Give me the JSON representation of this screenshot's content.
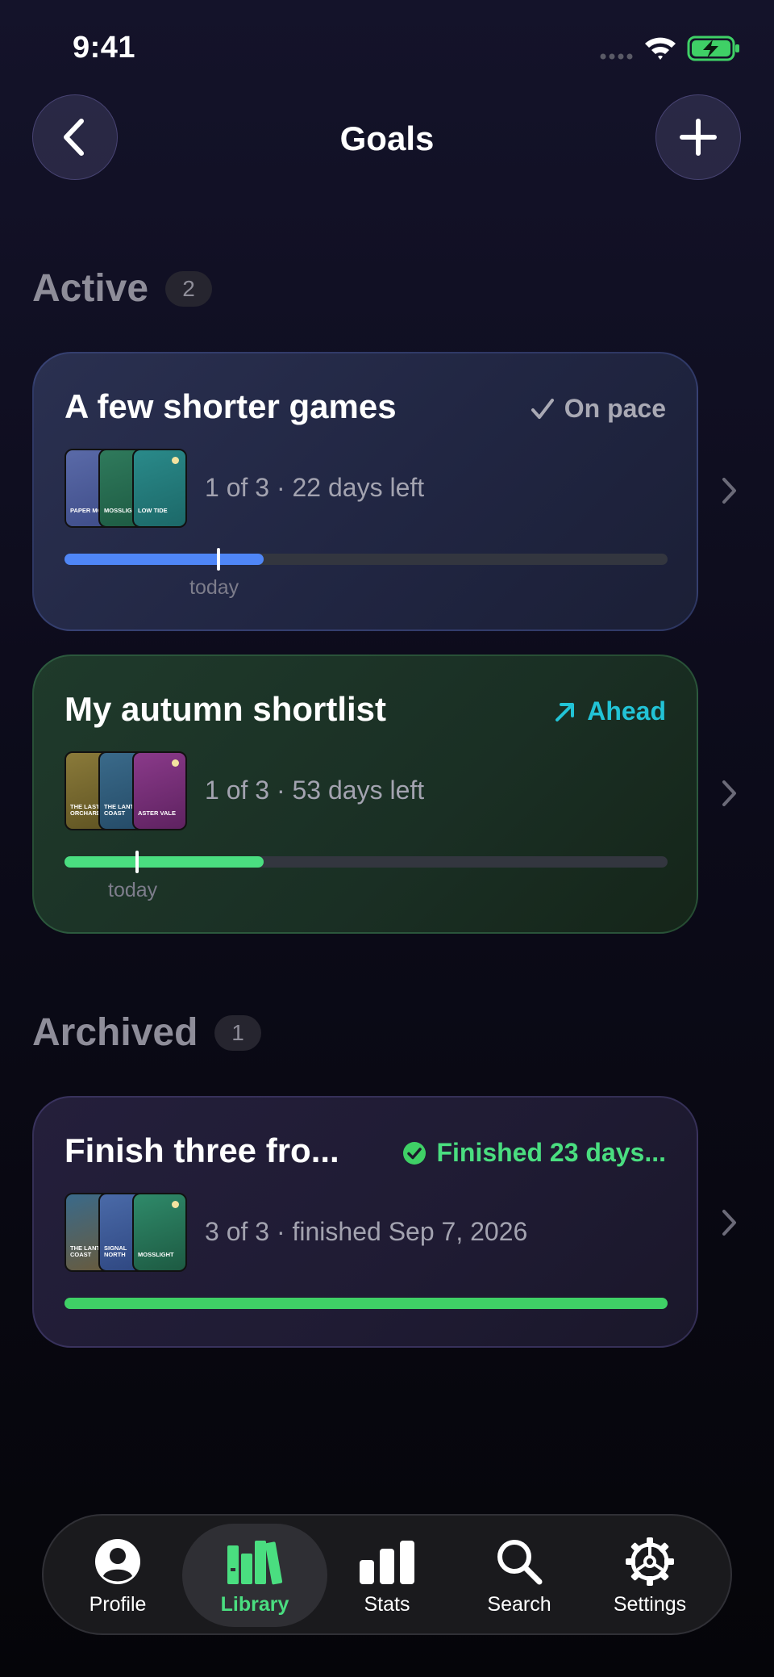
{
  "status_bar": {
    "time": "9:41"
  },
  "header": {
    "title": "Goals"
  },
  "sections": {
    "active": {
      "title": "Active",
      "count": "2"
    },
    "archived": {
      "title": "Archived",
      "count": "1"
    }
  },
  "goals": [
    {
      "title": "A few shorter games",
      "status": "On pace",
      "status_color": "#a9a9b4",
      "meta": "1 of 3 · 22 days left",
      "progress": 0.33,
      "today_position": 0.255,
      "today_label": "today",
      "bar_color": "#4f86f7",
      "covers": [
        {
          "label": "PAPER MOON",
          "colors": [
            "#5a6aa8",
            "#3e4c88"
          ]
        },
        {
          "label": "MOSSLIGHT",
          "colors": [
            "#2f7a5c",
            "#1d5a42"
          ]
        },
        {
          "label": "LOW TIDE",
          "colors": [
            "#2a8a8a",
            "#1c6868"
          ]
        }
      ]
    },
    {
      "title": "My autumn shortlist",
      "status": "Ahead",
      "status_color": "#22c3d6",
      "meta": "1 of 3 · 53 days left",
      "progress": 0.33,
      "today_position": 0.12,
      "today_label": "today",
      "bar_color": "#4ade80",
      "covers": [
        {
          "label": "THE LAST ORCHARD",
          "colors": [
            "#8a7a3a",
            "#5f5322"
          ]
        },
        {
          "label": "THE LANTERN COAST",
          "colors": [
            "#3a6a8a",
            "#244a66"
          ]
        },
        {
          "label": "ASTER VALE",
          "colors": [
            "#8a3a8a",
            "#5e2260"
          ]
        }
      ]
    }
  ],
  "archived_goals": [
    {
      "title": "Finish three fro...",
      "status": "Finished 23 days...",
      "status_color": "#4ade80",
      "meta": "3 of 3 · finished Sep 7, 2026",
      "progress": 1.0,
      "bar_color": "#3fd066",
      "covers": [
        {
          "label": "THE LANTERN COAST",
          "colors": [
            "#3a6a8a",
            "#6a5a3a"
          ]
        },
        {
          "label": "SIGNAL NORTH",
          "colors": [
            "#4a6aa8",
            "#2e4680"
          ]
        },
        {
          "label": "MOSSLIGHT",
          "colors": [
            "#2f8a6a",
            "#1d5a42"
          ]
        }
      ]
    }
  ],
  "tabs": [
    {
      "label": "Profile",
      "icon": "person-circle-icon",
      "active": false
    },
    {
      "label": "Library",
      "icon": "books-icon",
      "active": true
    },
    {
      "label": "Stats",
      "icon": "bar-chart-icon",
      "active": false
    },
    {
      "label": "Search",
      "icon": "magnifier-icon",
      "active": false
    },
    {
      "label": "Settings",
      "icon": "gear-icon",
      "active": false
    }
  ]
}
